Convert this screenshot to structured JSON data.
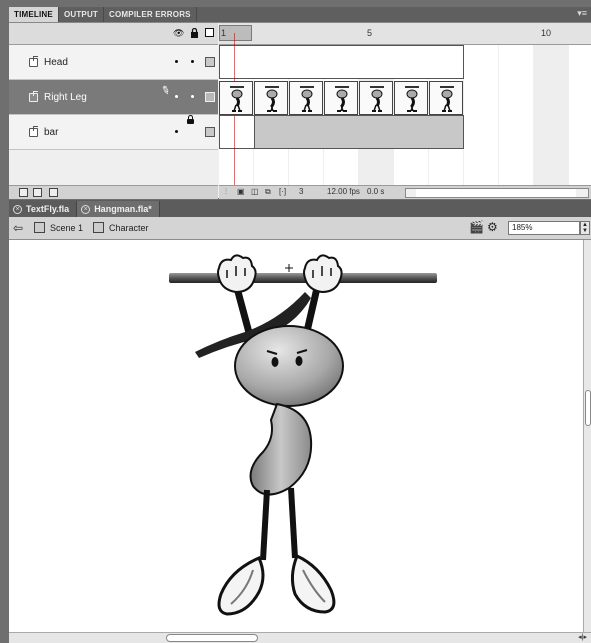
{
  "panel_tabs": [
    "TIMELINE",
    "OUTPUT",
    "COMPILER ERRORS"
  ],
  "timeline": {
    "layers": [
      {
        "name": "Head",
        "selected": false,
        "locked": false
      },
      {
        "name": "Right Leg",
        "selected": true,
        "locked": false
      },
      {
        "name": "bar",
        "selected": false,
        "locked": true
      }
    ],
    "ruler_numbers": [
      "1",
      "5",
      "10"
    ],
    "current_frame": "3",
    "fps": "12.00 fps",
    "elapsed": "0.0 s"
  },
  "doc_tabs": [
    {
      "label": "TextFly.fla",
      "active": false
    },
    {
      "label": "Hangman.fla*",
      "active": true
    }
  ],
  "edit_bar": {
    "scene": "Scene 1",
    "symbol": "Character",
    "zoom": "185%"
  },
  "colors": {
    "selected_layer": "#7a7a7a",
    "panel_dark": "#5f5f5f",
    "frame_span": "#c8c8c8"
  },
  "icons": [
    "back-arrow-icon",
    "clapper-icon",
    "symbol-icon",
    "eye-icon",
    "lock-icon",
    "outline-icon",
    "pencil-icon"
  ]
}
